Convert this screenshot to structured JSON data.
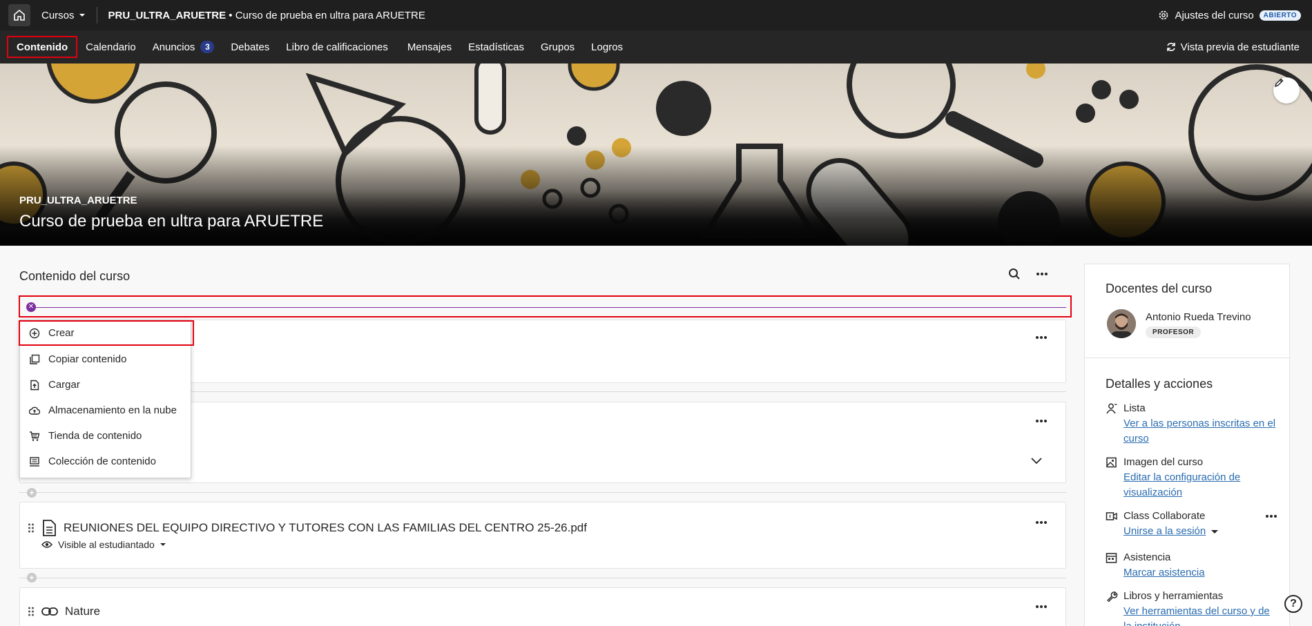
{
  "topbar": {
    "courses_label": "Cursos",
    "course_code": "PRU_ULTRA_ARUETRE",
    "separator": "•",
    "course_name": "Curso de prueba en ultra para ARUETRE",
    "settings_label": "Ajustes del curso",
    "status_badge": "ABIERTO"
  },
  "nav": {
    "items": [
      {
        "label": "Contenido"
      },
      {
        "label": "Calendario"
      },
      {
        "label": "Anuncios",
        "count": "3"
      },
      {
        "label": "Debates"
      },
      {
        "label": "Libro de calificaciones"
      },
      {
        "label": "Mensajes"
      },
      {
        "label": "Estadísticas"
      },
      {
        "label": "Grupos"
      },
      {
        "label": "Logros"
      }
    ],
    "student_preview": "Vista previa de estudiante"
  },
  "banner": {
    "code": "PRU_ULTRA_ARUETRE",
    "title": "Curso de prueba en ultra para ARUETRE"
  },
  "content": {
    "title": "Contenido del curso",
    "menu": [
      {
        "label": "Crear",
        "icon": "plus-circle-icon"
      },
      {
        "label": "Copiar contenido",
        "icon": "copy-icon"
      },
      {
        "label": "Cargar",
        "icon": "upload-icon"
      },
      {
        "label": "Almacenamiento en la nube",
        "icon": "cloud-upload-icon"
      },
      {
        "label": "Tienda de contenido",
        "icon": "cart-icon"
      },
      {
        "label": "Colección de contenido",
        "icon": "collection-icon"
      }
    ],
    "items": [
      {
        "title": "REUNIONES DEL EQUIPO DIRECTIVO Y TUTORES CON LAS FAMILIAS DEL CENTRO 25-26.pdf",
        "visibility": "Visible al estudiantado"
      },
      {
        "title": "Nature",
        "visibility": ""
      }
    ]
  },
  "panel": {
    "teachers_title": "Docentes del curso",
    "teacher_name": "Antonio Rueda Trevino",
    "teacher_role": "PROFESOR",
    "details_title": "Detalles y acciones",
    "details": [
      {
        "label": "Lista",
        "link": "Ver a las personas inscritas en el curso"
      },
      {
        "label": "Imagen del curso",
        "link": "Editar la configuración de visualización"
      },
      {
        "label": "Class Collaborate",
        "link": "Unirse a la sesión"
      },
      {
        "label": "Asistencia",
        "link": "Marcar asistencia"
      },
      {
        "label": "Libros y herramientas",
        "link": "Ver herramientas del curso y de la institución"
      }
    ]
  },
  "help_label": "?"
}
